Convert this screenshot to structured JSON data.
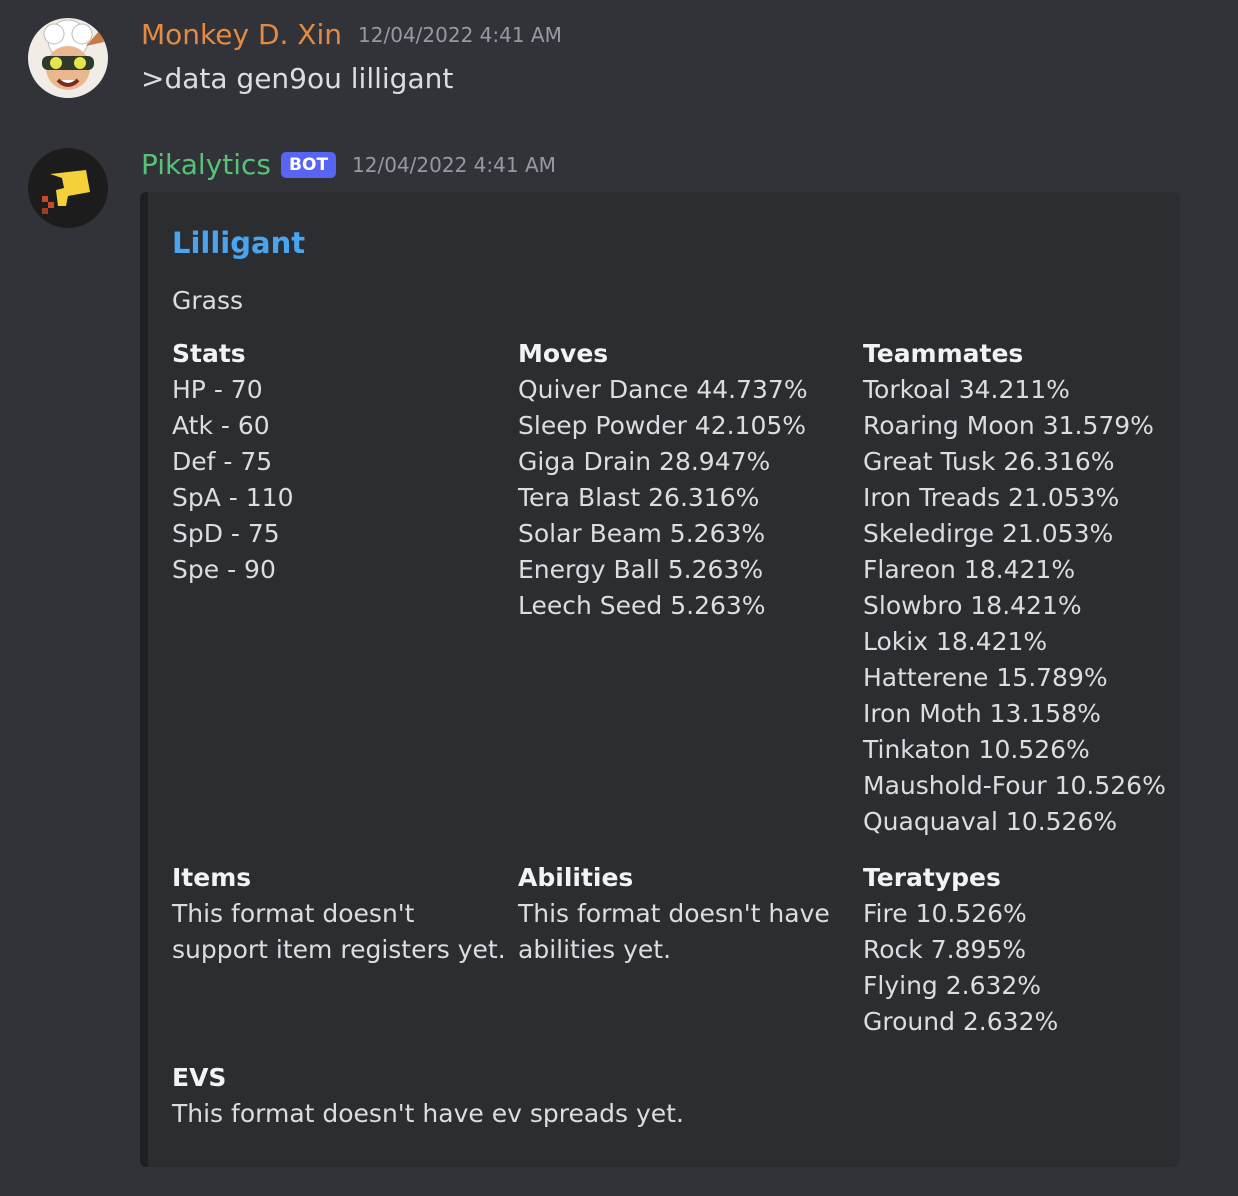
{
  "messages": [
    {
      "author": "Monkey D. Xin",
      "author_color": "#e58a42",
      "timestamp": "12/04/2022 4:41 AM",
      "content": ">data gen9ou lilligant"
    },
    {
      "author": "Pikalytics",
      "author_color": "#57c278",
      "bot_tag": "BOT",
      "timestamp": "12/04/2022 4:41 AM"
    }
  ],
  "embed": {
    "title": "Lilligant",
    "description": "Grass",
    "fields": {
      "stats": {
        "name": "Stats",
        "lines": [
          "HP - 70",
          "Atk - 60",
          "Def - 75",
          "SpA - 110",
          "SpD - 75",
          "Spe - 90"
        ]
      },
      "moves": {
        "name": "Moves",
        "lines": [
          "Quiver Dance 44.737%",
          "Sleep Powder 42.105%",
          "Giga Drain 28.947%",
          "Tera Blast 26.316%",
          "Solar Beam 5.263%",
          "Energy Ball 5.263%",
          "Leech Seed 5.263%"
        ]
      },
      "teammates": {
        "name": "Teammates",
        "lines": [
          "Torkoal 34.211%",
          "Roaring Moon 31.579%",
          "Great Tusk 26.316%",
          "Iron Treads 21.053%",
          "Skeledirge 21.053%",
          "Flareon 18.421%",
          "Slowbro 18.421%",
          "Lokix 18.421%",
          "Hatterene 15.789%",
          "Iron Moth 13.158%",
          "Tinkaton 10.526%",
          "Maushold-Four 10.526%",
          "Quaquaval 10.526%"
        ]
      },
      "items": {
        "name": "Items",
        "lines": [
          "This format doesn't",
          "support item registers yet."
        ]
      },
      "abilities": {
        "name": "Abilities",
        "lines": [
          "This format doesn't have",
          "abilities yet."
        ]
      },
      "teratypes": {
        "name": "Teratypes",
        "lines": [
          "Fire 10.526%",
          "Rock 7.895%",
          "Flying 2.632%",
          "Ground 2.632%"
        ]
      },
      "evs": {
        "name": "EVS",
        "lines": [
          "This format doesn't have ev spreads yet."
        ]
      }
    }
  }
}
